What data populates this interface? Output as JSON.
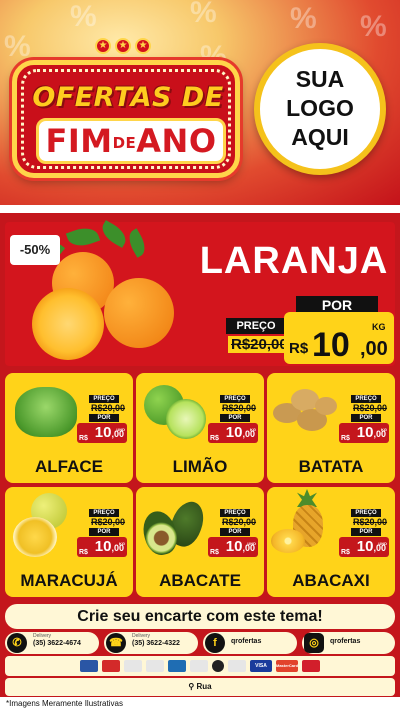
{
  "header": {
    "title_line1": "OFERTAS DE",
    "title_line2_a": "FIM",
    "title_line2_b": "DE",
    "title_line2_c": "ANO",
    "logo_line1": "SUA",
    "logo_line2": "LOGO",
    "logo_line3": "AQUI"
  },
  "hero": {
    "badge": "-50%",
    "product": "LARANJA",
    "preco_label": "PREÇO",
    "old_price": "R$20,00",
    "por_label": "POR",
    "currency": "R$",
    "price_int": "10",
    "price_dec": ",00",
    "unit": "KG"
  },
  "products": [
    {
      "name": "ALFACE",
      "preco_label": "PREÇO",
      "old_price": "R$20,00",
      "por_label": "POR",
      "currency": "R$",
      "price_int": "10",
      "price_dec": ",00",
      "unit": "UND"
    },
    {
      "name": "LIMÃO",
      "preco_label": "PREÇO",
      "old_price": "R$20,00",
      "por_label": "POR",
      "currency": "R$",
      "price_int": "10",
      "price_dec": ",00",
      "unit": "KG"
    },
    {
      "name": "BATATA",
      "preco_label": "PREÇO",
      "old_price": "R$20,00",
      "por_label": "POR",
      "currency": "R$",
      "price_int": "10",
      "price_dec": ",00",
      "unit": "KG"
    },
    {
      "name": "MARACUJÁ",
      "preco_label": "PREÇO",
      "old_price": "R$20,00",
      "por_label": "POR",
      "currency": "R$",
      "price_int": "10",
      "price_dec": ",00",
      "unit": "KG"
    },
    {
      "name": "ABACATE",
      "preco_label": "PREÇO",
      "old_price": "R$20,00",
      "por_label": "POR",
      "currency": "R$",
      "price_int": "10",
      "price_dec": ",00",
      "unit": "UND"
    },
    {
      "name": "ABACAXI",
      "preco_label": "PREÇO",
      "old_price": "R$20,00",
      "por_label": "POR",
      "currency": "R$",
      "price_int": "10",
      "price_dec": ",00",
      "unit": "UND"
    }
  ],
  "cta": "Crie seu encarte com este tema!",
  "contacts": [
    {
      "icon": "whatsapp-icon",
      "label": "Delivery",
      "value": "(35) 3622-4674"
    },
    {
      "icon": "phone-icon",
      "label": "Delivery",
      "value": "(35) 3622-4322"
    },
    {
      "icon": "facebook-icon",
      "label": "",
      "value": "qrofertas"
    },
    {
      "icon": "instagram-icon",
      "label": "",
      "value": "qrofertas"
    }
  ],
  "payments": [
    "VISA",
    "MasterCard"
  ],
  "address": "Rua",
  "footer": "*Imagens Meramente Ilustrativas",
  "colors": {
    "red": "#c4161c",
    "yellow": "#ffd319",
    "cream": "#fff7d6"
  }
}
